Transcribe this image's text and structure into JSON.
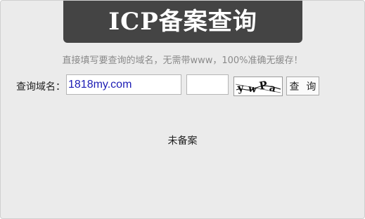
{
  "header": {
    "title": "ICP备案查询"
  },
  "hint_text": "直接填写要查询的域名，无需带www，100%准确无缓存！",
  "form": {
    "domain_label": "查询域名：",
    "domain_value": "1818my.com",
    "captcha_value": "",
    "captcha_image_text": "ywPa",
    "search_button_label": "查 询"
  },
  "result": {
    "status_text": "未备案"
  }
}
